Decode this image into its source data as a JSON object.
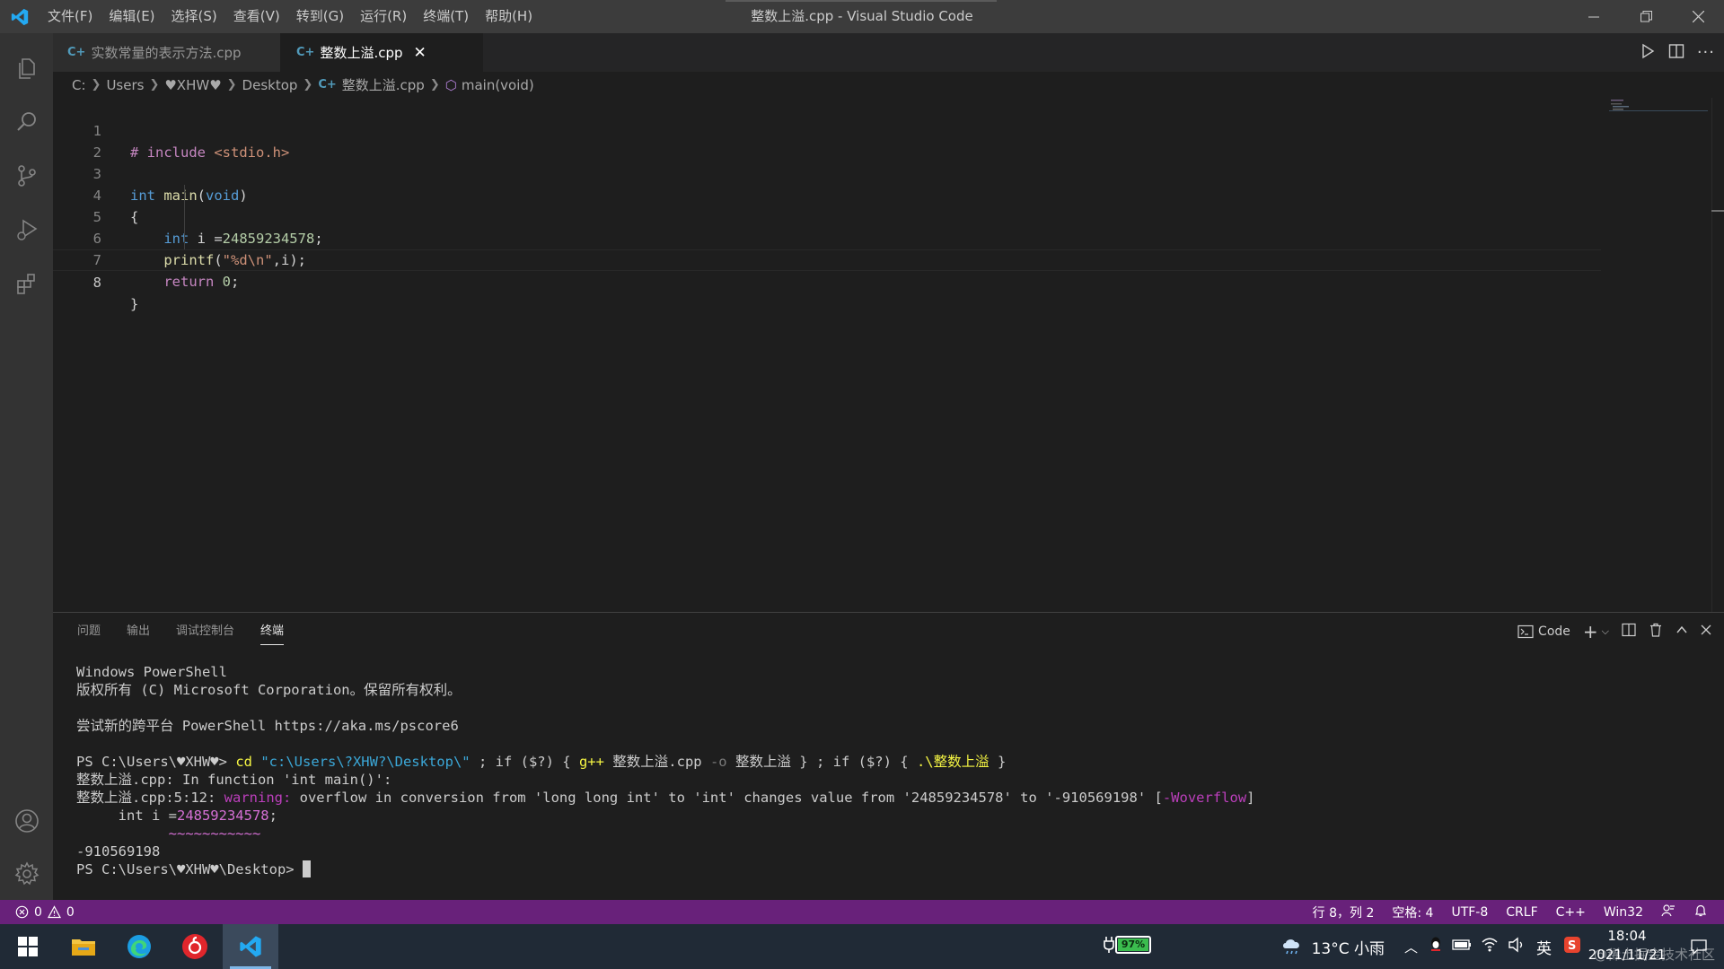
{
  "window": {
    "title": "整数上溢.cpp - Visual Studio Code",
    "menu": [
      "文件(F)",
      "编辑(E)",
      "选择(S)",
      "查看(V)",
      "转到(G)",
      "运行(R)",
      "终端(T)",
      "帮助(H)"
    ]
  },
  "tabs": [
    {
      "label": "实数常量的表示方法.cpp",
      "active": false
    },
    {
      "label": "整数上溢.cpp",
      "active": true
    }
  ],
  "breadcrumb": {
    "drive": "C:",
    "users": "Users",
    "user": "♥XHW♥",
    "desktop": "Desktop",
    "file": "整数上溢.cpp",
    "symbol": "main(void)"
  },
  "editor": {
    "line_numbers": [
      "1",
      "2",
      "3",
      "4",
      "5",
      "6",
      "7",
      "8"
    ],
    "current_line": 8
  },
  "panel": {
    "tabs": [
      "问题",
      "输出",
      "调试控制台",
      "终端"
    ],
    "active_tab": "终端",
    "terminal_profile": "Code",
    "terminal": {
      "l1": "Windows PowerShell",
      "l2": "版权所有 (C) Microsoft Corporation。保留所有权利。",
      "l3": "尝试新的跨平台 PowerShell https://aka.ms/pscore6",
      "ps1": "PS C:\\Users\\♥XHW♥> ",
      "cd": "cd",
      "cdpath": "\"c:\\Users\\?XHW?\\Desktop\\\"",
      "rest1": " ; if ($?) { ",
      "gpp": "g++",
      "gpp_args": " 整数上溢.cpp ",
      "oflag": "-o",
      "oname": " 整数上溢 } ; if ($?) { ",
      "run": ".\\整数上溢",
      "close": " }",
      "l5": "整数上溢.cpp: In function 'int main()':",
      "l6a": "整数上溢.cpp:5:12: ",
      "l6warn": "warning:",
      "l6b": " overflow in conversion from 'long long int' to 'int' changes value from '24859234578' to '-910569198' [",
      "l6flag": "-Woverflow",
      "l6c": "]",
      "l7a": "     int i =",
      "l7num": "24859234578",
      "l7b": ";",
      "squiggle": "~~~~~~~~~~~",
      "output": "-910569198",
      "ps2": "PS C:\\Users\\♥XHW♥\\Desktop> "
    }
  },
  "status": {
    "errors": "0",
    "warnings": "0",
    "position": "行 8，列 2",
    "spaces": "空格: 4",
    "encoding": "UTF-8",
    "eol": "CRLF",
    "language": "C++",
    "platform": "Win32"
  },
  "taskbar": {
    "battery": "97%",
    "weather": "13°C 小雨",
    "ime": "英",
    "time": "18:04",
    "date": "2021/11/21",
    "watermark": "@稀土掘金技术社区"
  },
  "colors": {
    "statusbar": "#68217a",
    "activitybar": "#333333",
    "editor_bg": "#1e1e1e",
    "taskbar": "#202a36"
  }
}
